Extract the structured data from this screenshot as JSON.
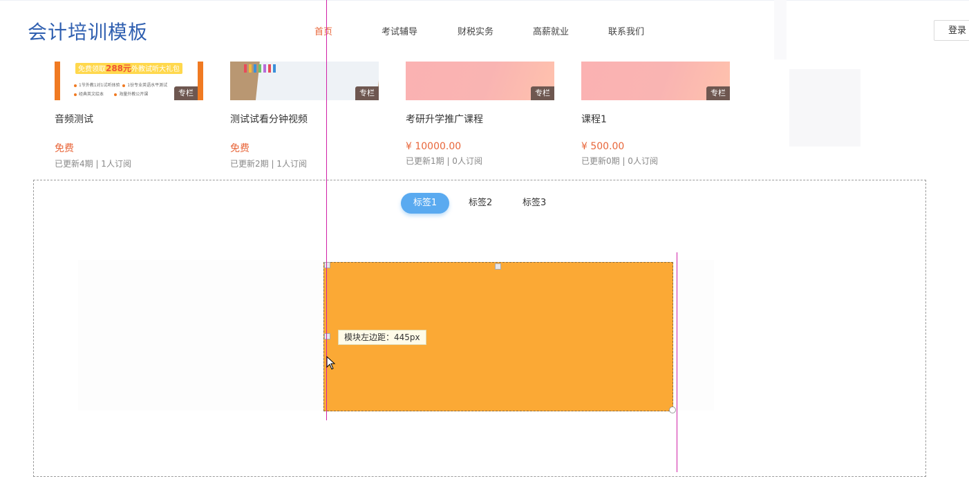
{
  "header": {
    "logo": "会计培训模板",
    "nav": [
      "首页",
      "考试辅导",
      "财税实务",
      "高薪就业",
      "联系我们"
    ],
    "active_nav": "首页",
    "login_label": "登录"
  },
  "courses": [
    {
      "title": "音频测试",
      "price": "免费",
      "meta": "已更新4期 | 1人订阅",
      "badge": "专栏",
      "thumb": "promo",
      "promo": {
        "banner_pre": "免费领取",
        "banner_amount": "288元",
        "banner_post": "外教试听大礼包",
        "lines": [
          "1节外教1对1试听体验",
          "1份专业英语水平测试",
          "经典英文绘本",
          "海量外教公开课"
        ]
      }
    },
    {
      "title": "测试试看分钟视频",
      "price": "免费",
      "meta": "已更新2期 | 1人订阅",
      "badge": "专栏",
      "thumb": "photo"
    },
    {
      "title": "考研升学推广课程",
      "price": "¥ 10000.00",
      "meta": "已更新1期 | 0人订阅",
      "badge": "专栏",
      "thumb": "pink"
    },
    {
      "title": "课程1",
      "price": "¥ 500.00",
      "meta": "已更新0期 | 0人订阅",
      "badge": "专栏",
      "thumb": "pink"
    }
  ],
  "tabs": [
    "标签1",
    "标签2",
    "标签3"
  ],
  "active_tab": "标签1",
  "tooltip": "模块左边距：445px",
  "colors": {
    "brand_blue": "#2f5fb0",
    "accent_orange": "#e8663a",
    "tab_active_bg": "#5aaaf0",
    "module_fill": "#fba935",
    "guide_line": "#d01fa6"
  },
  "icons": [
    "cursor-arrow-icon",
    "resize-handle-icon"
  ]
}
